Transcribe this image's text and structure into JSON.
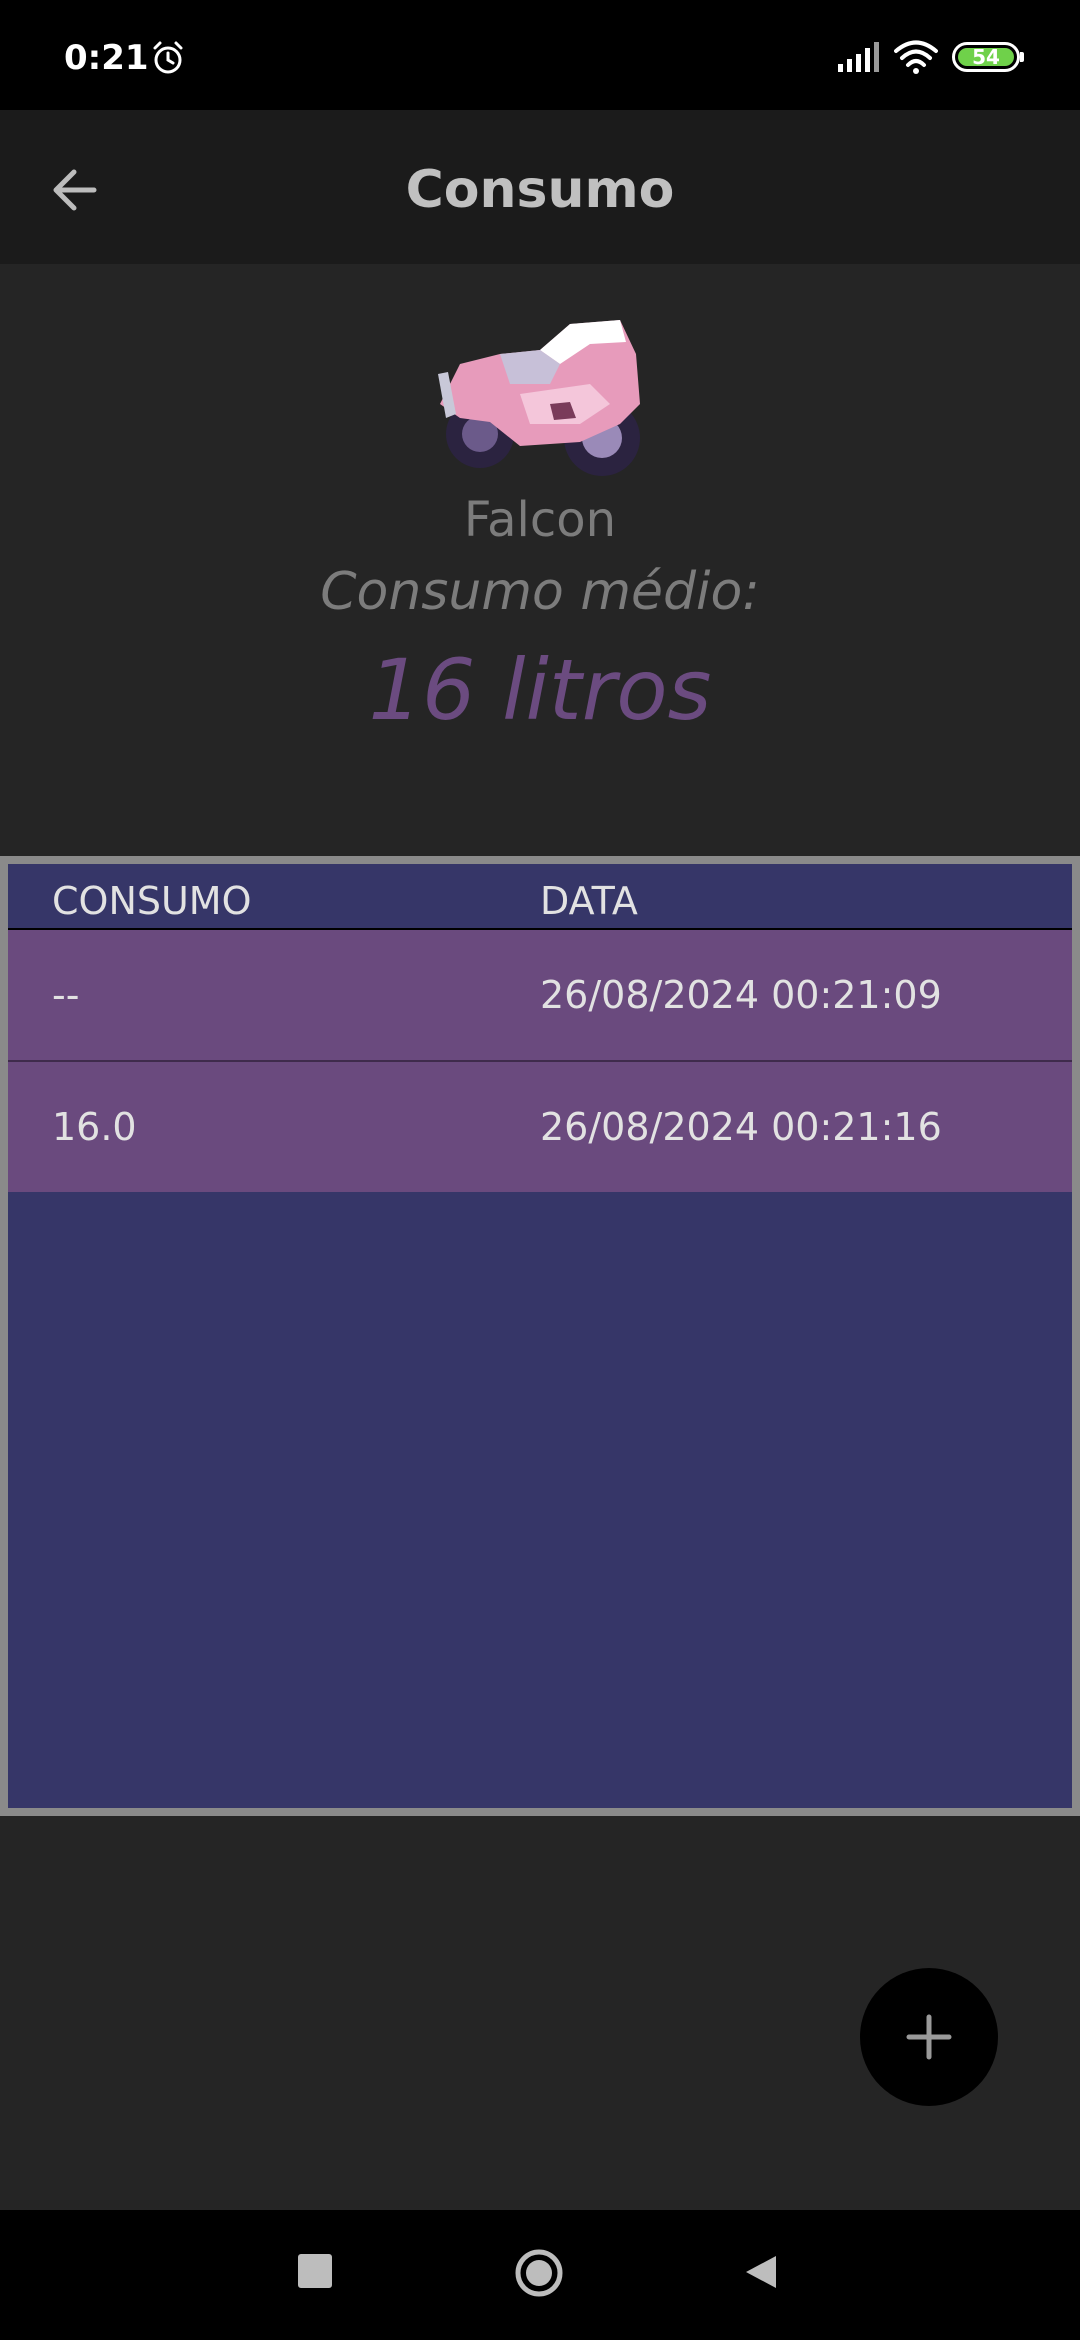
{
  "status_bar": {
    "time": "0:21",
    "battery_level": "54",
    "icons": [
      "alarm-icon",
      "signal-icon",
      "wifi-icon",
      "battery-icon"
    ]
  },
  "app_bar": {
    "title": "Consumo",
    "back_icon": "arrow-left-icon"
  },
  "header": {
    "vehicle_name": "Falcon",
    "consumo_label": "Consumo médio:",
    "consumo_value": "16 litros",
    "image": "motorcycle-image"
  },
  "table": {
    "columns": [
      "CONSUMO",
      "DATA"
    ],
    "rows": [
      {
        "consumo": "--",
        "data": "26/08/2024 00:21:09"
      },
      {
        "consumo": "16.0",
        "data": "26/08/2024 00:21:16"
      }
    ]
  },
  "fab": {
    "icon": "plus-icon"
  },
  "nav_bar": {
    "icons": [
      "recents-icon",
      "home-icon",
      "back-icon"
    ]
  },
  "colors": {
    "background": "#252525",
    "status_bar": "#000000",
    "app_bar": "#1b1b1b",
    "title_text": "#c0c0c0",
    "muted_text": "#7c7c7c",
    "accent_value": "#6b4b80",
    "table_bg": "#363668",
    "table_row": "#6a4a7e",
    "table_border": "#8a8a8a",
    "fab": "#000000"
  }
}
